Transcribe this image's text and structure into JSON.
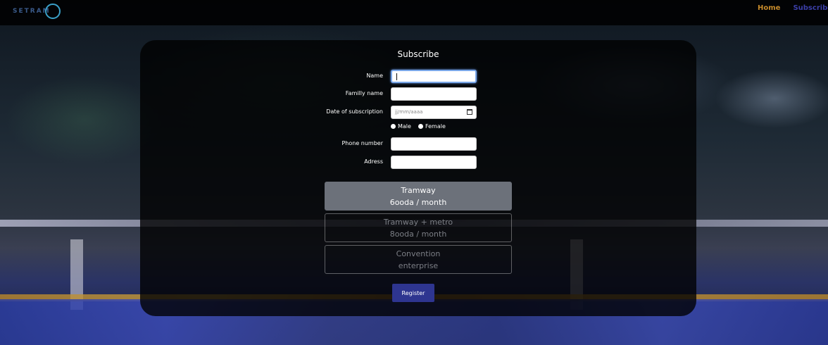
{
  "brand": {
    "logo_text": "SETRAM"
  },
  "nav": {
    "home": "Home",
    "subscribe": "Subscribe"
  },
  "form": {
    "title": "Subscribe",
    "fields": {
      "name": {
        "label": "Name",
        "value": ""
      },
      "family_name": {
        "label": "Familly name",
        "value": ""
      },
      "date": {
        "label": "Date of subscription",
        "placeholder": "jj/mm/aaaa"
      },
      "phone": {
        "label": "Phone number",
        "value": ""
      },
      "address": {
        "label": "Adress",
        "value": ""
      }
    },
    "gender": {
      "male": "Male",
      "female": "Female"
    },
    "plans": [
      {
        "line1": "Tramway",
        "line2": "6ooda / month",
        "selected": true
      },
      {
        "line1": "Tramway + metro",
        "line2": "8ooda / month",
        "selected": false
      },
      {
        "line1": "Convention",
        "line2": "enterprise",
        "selected": false
      }
    ],
    "register_label": "Register"
  },
  "colors": {
    "accent_home": "#c58a2a",
    "accent_nav": "#3b3fa8",
    "button": "#2e3590",
    "selected_plan": "#6c717a"
  }
}
